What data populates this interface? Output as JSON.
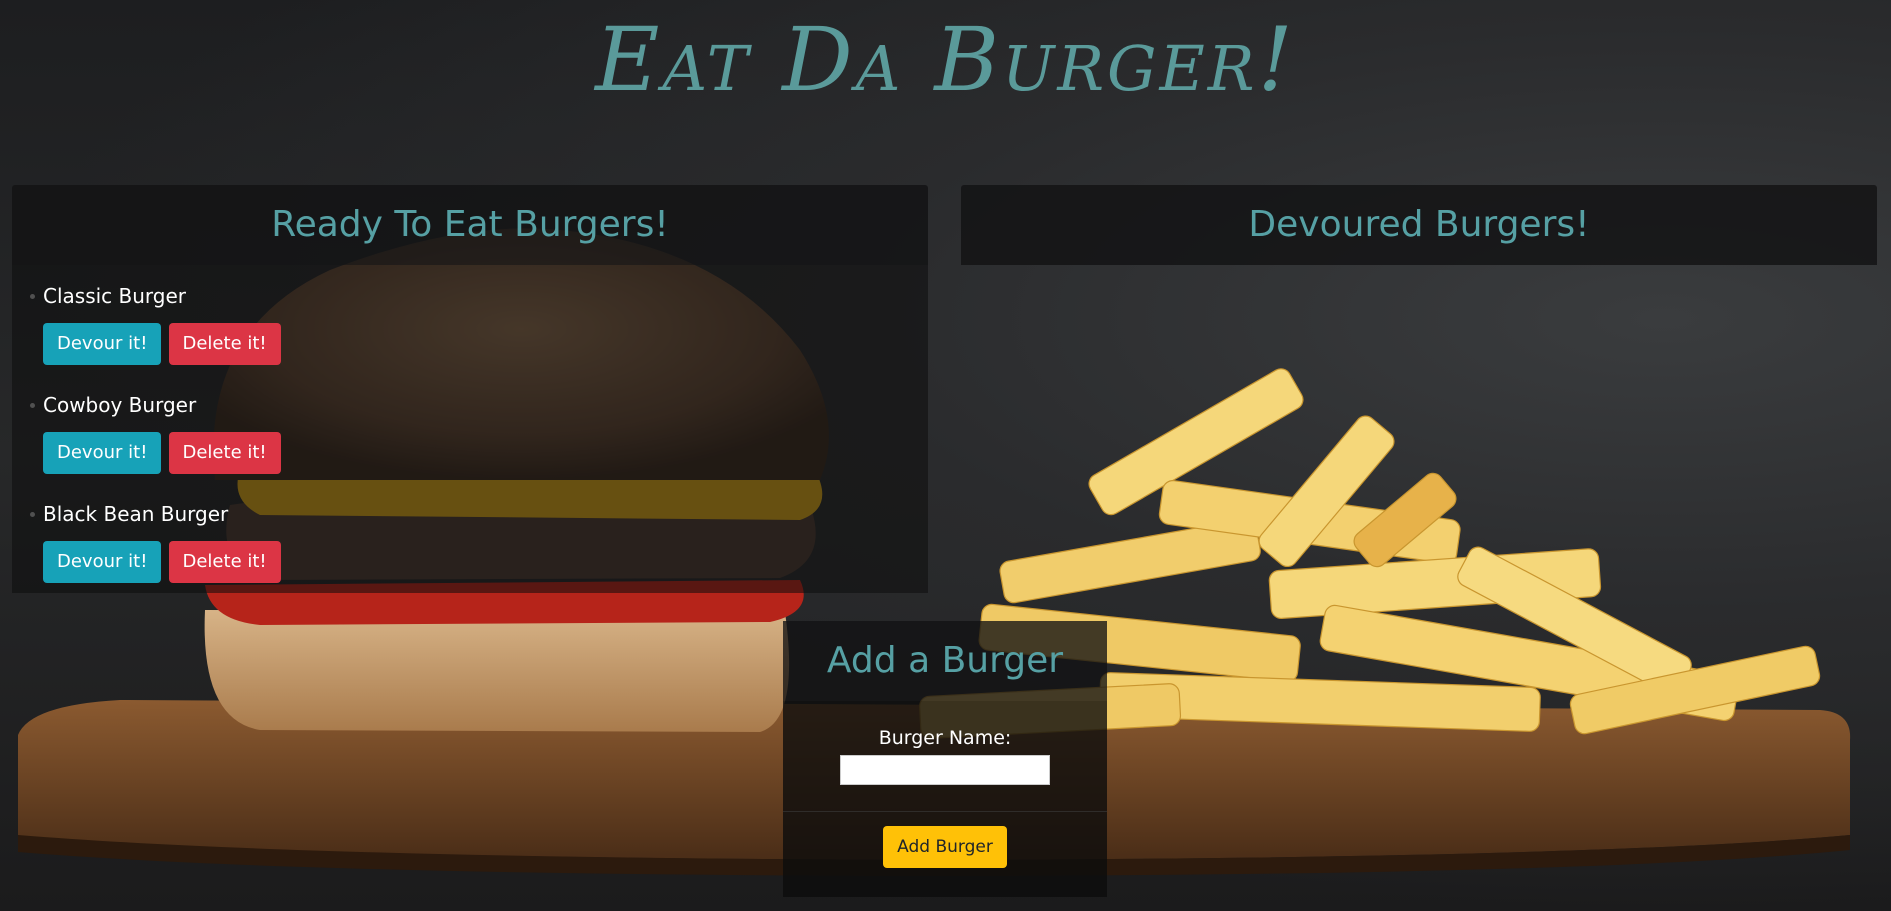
{
  "site": {
    "title": "Eat Da Burger!"
  },
  "ready": {
    "heading": "Ready To Eat Burgers!",
    "burgers": [
      {
        "name": "Classic Burger",
        "devour_label": "Devour it!",
        "delete_label": "Delete it!"
      },
      {
        "name": "Cowboy Burger",
        "devour_label": "Devour it!",
        "delete_label": "Delete it!"
      },
      {
        "name": "Black Bean Burger",
        "devour_label": "Devour it!",
        "delete_label": "Delete it!"
      }
    ]
  },
  "devoured": {
    "heading": "Devoured Burgers!"
  },
  "add_form": {
    "heading": "Add a Burger",
    "name_label": "Burger Name:",
    "name_value": "",
    "submit_label": "Add Burger"
  },
  "colors": {
    "heading_teal": "#56a0a4",
    "devour_button": "#17a2b8",
    "delete_button": "#dc3545",
    "add_button": "#ffc107"
  }
}
